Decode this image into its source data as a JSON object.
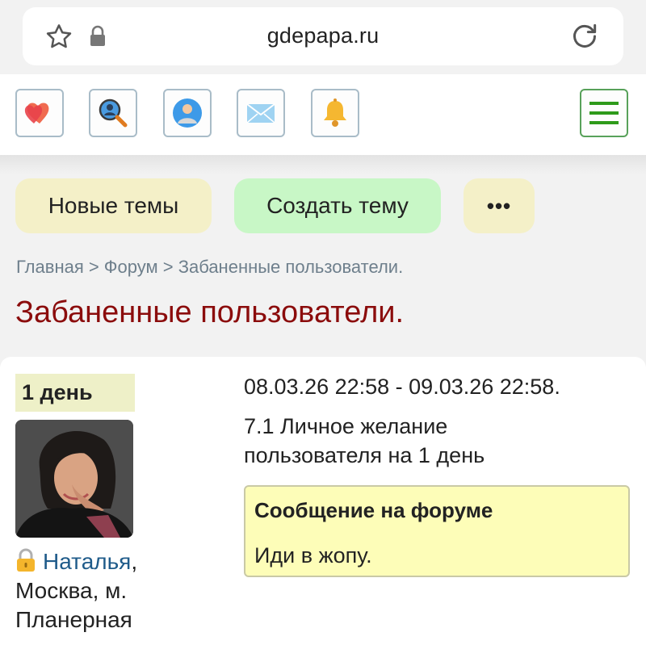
{
  "browser": {
    "domain": "gdepapa.ru",
    "icons": [
      "star-icon",
      "lock-icon",
      "reload-icon"
    ]
  },
  "toolbar": {
    "icons": [
      "hearts-icon",
      "search-people-icon",
      "profile-icon",
      "mail-icon",
      "bell-icon",
      "menu-icon"
    ]
  },
  "actions": {
    "new_topics": "Новые темы",
    "create_topic": "Создать тему",
    "more": "•••"
  },
  "breadcrumb": "Главная > Форум > Забаненные пользователи.",
  "page_title": "Забаненные пользователи.",
  "ban": {
    "duration": "1 день",
    "user_name": "Наталья",
    "user_location_sep": ",",
    "user_location": "Москва, м. Планерная",
    "period": "08.03.26 22:58 - 09.03.26 22:58.",
    "reason": "7.1 Личное желание пользователя на 1 день",
    "message_header": "Сообщение на форуме",
    "message_text": "Иди в жопу."
  },
  "colors": {
    "title": "#8b0c0c",
    "username_link": "#1f5b8a",
    "new_topics_bg": "#f4f0c8",
    "create_topic_bg": "#c8f7c6",
    "message_bg": "#fdfdb8"
  }
}
